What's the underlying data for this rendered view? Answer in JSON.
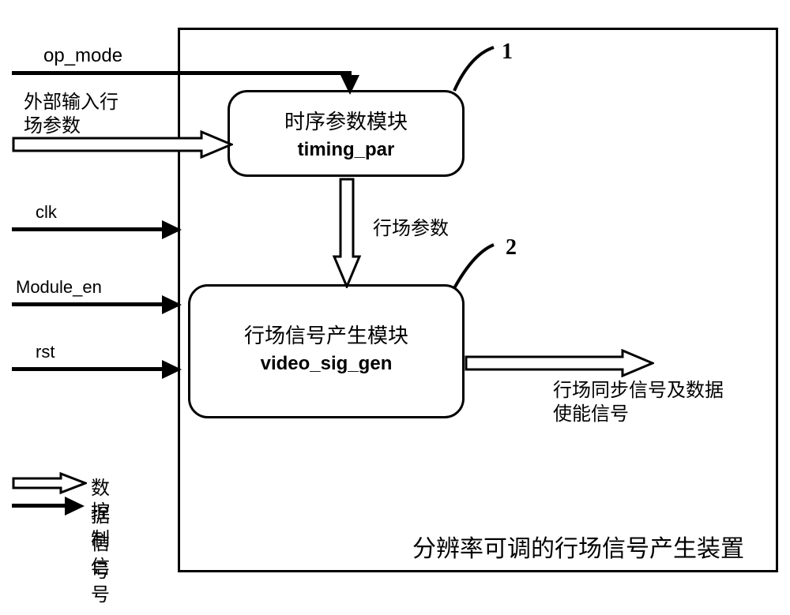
{
  "inputs": {
    "op_mode": "op_mode",
    "ext_params_line1": "外部输入行",
    "ext_params_line2": "场参数",
    "clk": "clk",
    "module_en": "Module_en",
    "rst": "rst"
  },
  "modules": {
    "m1": {
      "title_cn": "时序参数模块",
      "title_en": "timing_par",
      "num": "1"
    },
    "m2": {
      "title_cn": "行场信号产生模块",
      "title_en": "video_sig_gen",
      "num": "2"
    }
  },
  "connections": {
    "mid": "行场参数"
  },
  "outputs": {
    "out_line1": "行场同步信号及数据",
    "out_line2": "使能信号"
  },
  "legend": {
    "data": "数据信号",
    "ctrl": "控制信号"
  },
  "caption": "分辨率可调的行场信号产生装置"
}
